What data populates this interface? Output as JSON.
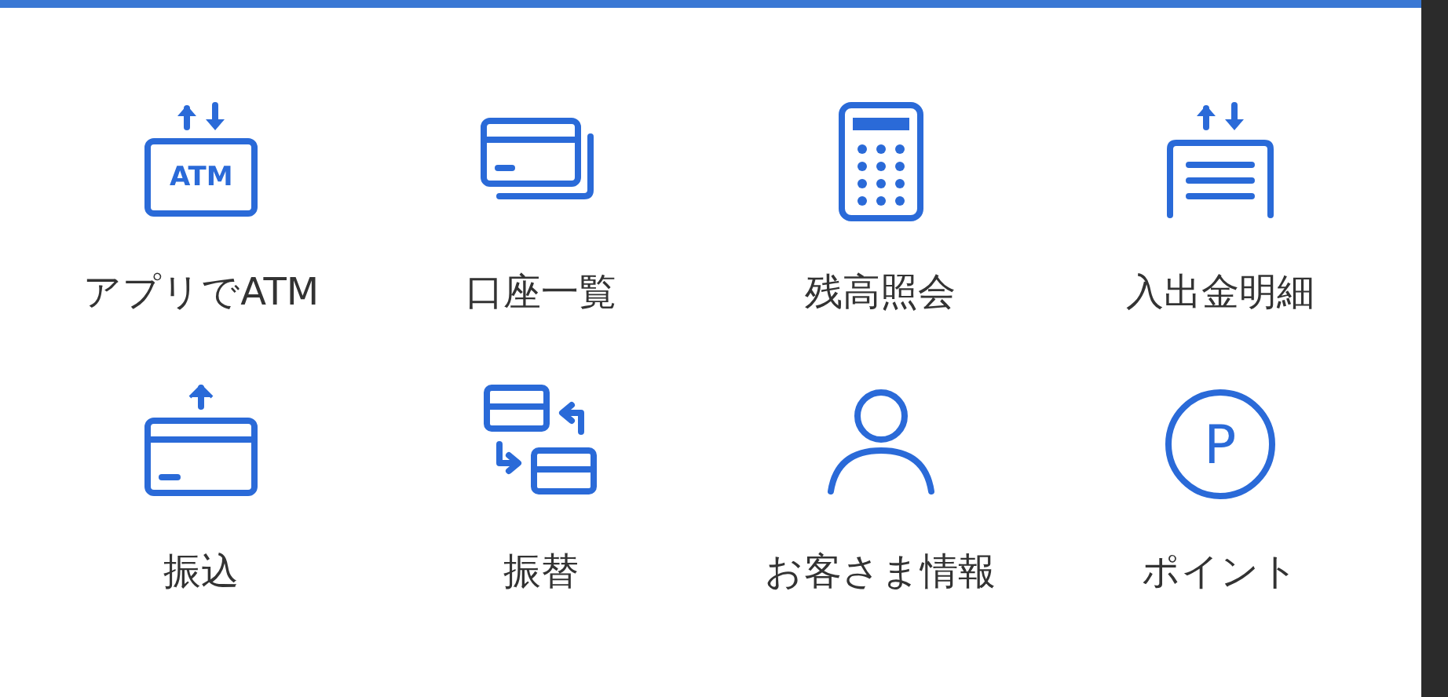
{
  "menu": [
    {
      "label": "アプリでATM",
      "icon_text": "ATM"
    },
    {
      "label": "口座一覧"
    },
    {
      "label": "残高照会"
    },
    {
      "label": "入出金明細"
    },
    {
      "label": "振込"
    },
    {
      "label": "振替"
    },
    {
      "label": "お客さま情報"
    },
    {
      "label": "ポイント",
      "icon_text": "P"
    }
  ]
}
